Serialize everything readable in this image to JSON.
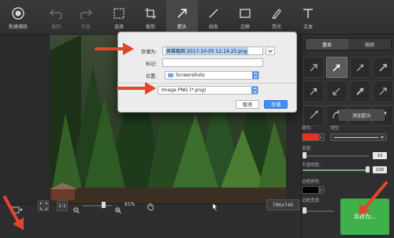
{
  "toolbar": {
    "items": [
      {
        "label": "新建捕获",
        "icon": "record-icon"
      },
      {
        "label": "撤回",
        "icon": "undo-icon"
      },
      {
        "label": "恢复",
        "icon": "redo-icon"
      },
      {
        "label": "选择",
        "icon": "select-icon"
      },
      {
        "label": "裁剪",
        "icon": "crop-icon"
      },
      {
        "label": "箭头",
        "icon": "arrow-tool-icon"
      },
      {
        "label": "线条",
        "icon": "line-icon"
      },
      {
        "label": "边框",
        "icon": "rectangle-icon"
      },
      {
        "label": "荧光",
        "icon": "highlighter-icon"
      },
      {
        "label": "文本",
        "icon": "text-icon"
      }
    ]
  },
  "dialog": {
    "save_as_label": "存储为:",
    "save_as_value": "屏幕截图 2017-10-05 12.14.25.png",
    "tags_label": "标记:",
    "tags_value": "",
    "location_label": "位置:",
    "location_value": "Screenshots",
    "format_value": "Image PNG (*.png)",
    "cancel_label": "取消",
    "save_label": "存储"
  },
  "panel": {
    "tabs": [
      "基本",
      "插图"
    ],
    "selected_tab": "基本",
    "add_arrow_label": "添加箭头",
    "color_label": "颜色:",
    "line_type_label": "线型:",
    "width_label": "宽度:",
    "width_value": "10",
    "opacity_label": "不透明度:",
    "opacity_value": "100",
    "border_color_label": "边框颜色:",
    "border_width_label": "边框宽度:",
    "border_width_value": "0",
    "save_as_button": "另存为...",
    "colors": {
      "arrow_color": "#e8311f",
      "border_color": "#000000"
    }
  },
  "bottom": {
    "zoom_fit": "1:1",
    "zoom_percent": "61%",
    "image_size": "796x740"
  },
  "accent": {
    "annotation_red": "#e2452b",
    "save_green": "#3fb14b",
    "dialog_blue": "#3f8ef2"
  }
}
